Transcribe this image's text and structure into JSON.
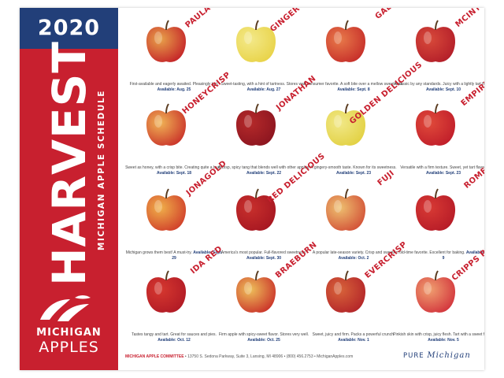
{
  "sidebar": {
    "year": "2020",
    "title": "HARVEST",
    "subtitle": "MICHIGAN APPLE SCHEDULE",
    "brand_line1": "MICHIGAN",
    "brand_line2": "APPLES"
  },
  "colors": {
    "brand_red": "#c8202f",
    "brand_blue": "#223f79"
  },
  "apples": [
    {
      "name": "PAULA RED",
      "description": "First-available and eagerly awaited. Pleasingly tart.",
      "available": "Available: Aug. 25",
      "fruit_color": "#c62a2a",
      "blush_color": "#e8a24a"
    },
    {
      "name": "GINGER GOLD",
      "description": "Sweet-tasting, with a hint of tartness. Stores well.",
      "available": "Available: Aug. 27",
      "fruit_color": "#e9d44b",
      "blush_color": "#f3e98a"
    },
    {
      "name": "GALA",
      "description": "A consumer favorite. A soft bite over a mellow sweetness.",
      "available": "Available: Sept. 8",
      "fruit_color": "#c8322b",
      "blush_color": "#e87a4a"
    },
    {
      "name": "MCINTOSH",
      "description": "A classic by any standards. Juicy with a lightly tart flavor.",
      "available": "Available: Sept. 10",
      "fruit_color": "#b5202a",
      "blush_color": "#d84a3a"
    },
    {
      "name": "HONEYCRISP",
      "description": "Sweet as honey, with a crisp bite. Creating quite a buzz!",
      "available": "Available: Sept. 18",
      "fruit_color": "#cc3a2c",
      "blush_color": "#f0b455"
    },
    {
      "name": "JONATHAN",
      "description": "A crisp, spicy tang that blends well with other apples.",
      "available": "Available: Sept. 22",
      "fruit_color": "#8e1620",
      "blush_color": "#b52a2a"
    },
    {
      "name": "GOLDEN DELICIOUS",
      "description": "A gingery-smooth taste. Known for its sweetness.",
      "available": "Available: Sept. 23",
      "fruit_color": "#e3d246",
      "blush_color": "#f1e888"
    },
    {
      "name": "EMPIRE",
      "description": "Versatile with a firm texture. Sweet, yet tart flavor.",
      "available": "Available: Sept. 23",
      "fruit_color": "#c2202b",
      "blush_color": "#e04a3a"
    },
    {
      "name": "JONAGOLD",
      "description": "Michigan grows them best! A must-try.",
      "available": "Available: Sept. 29",
      "fruit_color": "#d2452c",
      "blush_color": "#f0b04a"
    },
    {
      "name": "RED DELICIOUS",
      "description": "America's most popular. Full-flavored sweetness.",
      "available": "Available: Sept. 30",
      "fruit_color": "#a81822",
      "blush_color": "#c8302c"
    },
    {
      "name": "FUJI",
      "description": "A popular late-season variety. Crisp and sweet.",
      "available": "Available: Oct. 2",
      "fruit_color": "#d4573a",
      "blush_color": "#eec070"
    },
    {
      "name": "ROME",
      "description": "An old-time favorite. Excellent for baking.",
      "available": "Available: Oct. 9",
      "fruit_color": "#b81d28",
      "blush_color": "#d83a34"
    },
    {
      "name": "IDA RED",
      "description": "Tastes tangy and tart. Great for sauces and pies.",
      "available": "Available: Oct. 12",
      "fruit_color": "#b31c26",
      "blush_color": "#d6382f"
    },
    {
      "name": "BRAEBURN",
      "description": "Firm apple with spicy-sweet flavor. Stores very well.",
      "available": "Available: Oct. 25",
      "fruit_color": "#cc3a2c",
      "blush_color": "#eec05a"
    },
    {
      "name": "EVERCRISP",
      "description": "Sweet, juicy and firm. Packs a powerful crunch.",
      "available": "Available: Nov. 1",
      "fruit_color": "#b5282a",
      "blush_color": "#d8643a"
    },
    {
      "name": "CRIPPS PINK",
      "description": "Pinkish skin with crisp, juicy flesh. Tart with a sweet finish.",
      "available": "Available: Nov. 5",
      "fruit_color": "#d43a3f",
      "blush_color": "#f0a070"
    }
  ],
  "footer": {
    "org": "MICHIGAN APPLE COMMITTEE",
    "contact": " • 13750 S. Sedona Parkway, Suite 3, Lansing, MI 48906 • (800) 456.2753 • MichiganApples.com",
    "pure": "PURE",
    "michigan": "Michigan"
  }
}
